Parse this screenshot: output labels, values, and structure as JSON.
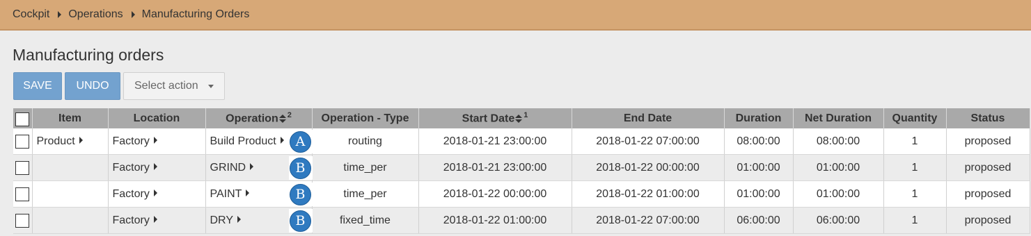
{
  "breadcrumb": [
    "Cockpit",
    "Operations",
    "Manufacturing Orders"
  ],
  "page_title": "Manufacturing orders",
  "toolbar": {
    "save_label": "SAVE",
    "undo_label": "UNDO",
    "select_action_label": "Select action"
  },
  "colors": {
    "breadcrumb_bg": "#d7a877",
    "primary_button": "#73a2cf",
    "header_bg": "#a9a9a9",
    "badge": "#2f7ac0"
  },
  "table": {
    "columns": [
      {
        "label": "Item"
      },
      {
        "label": "Location"
      },
      {
        "label": "Operation",
        "sort_rank": "2"
      },
      {
        "label": "Operation - Type"
      },
      {
        "label": "Start Date",
        "sort_rank": "1"
      },
      {
        "label": "End Date"
      },
      {
        "label": "Duration"
      },
      {
        "label": "Net Duration"
      },
      {
        "label": "Quantity"
      },
      {
        "label": "Status"
      }
    ],
    "rows": [
      {
        "item": "Product",
        "location": "Factory",
        "operation": "Build Product",
        "badge": "A",
        "type": "routing",
        "start": "2018-01-21 23:00:00",
        "end": "2018-01-22 07:00:00",
        "duration": "08:00:00",
        "net_duration": "08:00:00",
        "quantity": "1",
        "status": "proposed"
      },
      {
        "item": "",
        "location": "Factory",
        "operation": "GRIND",
        "badge": "B",
        "type": "time_per",
        "start": "2018-01-21 23:00:00",
        "end": "2018-01-22 00:00:00",
        "duration": "01:00:00",
        "net_duration": "01:00:00",
        "quantity": "1",
        "status": "proposed"
      },
      {
        "item": "",
        "location": "Factory",
        "operation": "PAINT",
        "badge": "B",
        "type": "time_per",
        "start": "2018-01-22 00:00:00",
        "end": "2018-01-22 01:00:00",
        "duration": "01:00:00",
        "net_duration": "01:00:00",
        "quantity": "1",
        "status": "proposed"
      },
      {
        "item": "",
        "location": "Factory",
        "operation": "DRY",
        "badge": "B",
        "type": "fixed_time",
        "start": "2018-01-22 01:00:00",
        "end": "2018-01-22 07:00:00",
        "duration": "06:00:00",
        "net_duration": "06:00:00",
        "quantity": "1",
        "status": "proposed"
      }
    ]
  }
}
